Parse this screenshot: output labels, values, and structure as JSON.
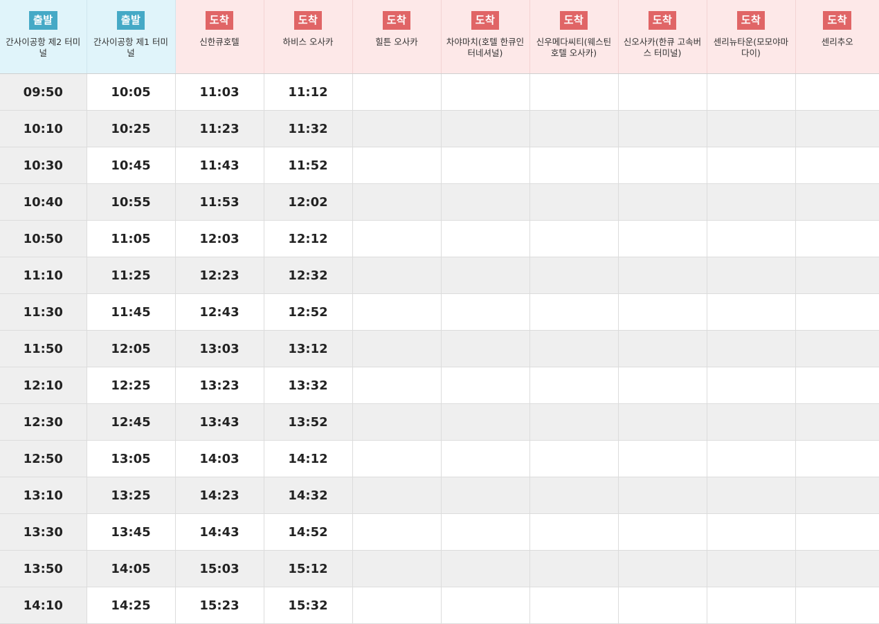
{
  "headers": [
    {
      "badge": "출발",
      "type": "dep",
      "station": "간사이공항 제2 터미널"
    },
    {
      "badge": "출발",
      "type": "dep",
      "station": "간사이공항 제1 터미널"
    },
    {
      "badge": "도착",
      "type": "arr",
      "station": "신한큐호텔"
    },
    {
      "badge": "도착",
      "type": "arr",
      "station": "하비스 오사카"
    },
    {
      "badge": "도착",
      "type": "arr",
      "station": "힐튼 오사카"
    },
    {
      "badge": "도착",
      "type": "arr",
      "station": "차야마치(호텔 한큐인터네셔널)"
    },
    {
      "badge": "도착",
      "type": "arr",
      "station": "신우메다씨티(웨스틴호텔 오사카)"
    },
    {
      "badge": "도착",
      "type": "arr",
      "station": "신오사카(한큐 고속버스 터미널)"
    },
    {
      "badge": "도착",
      "type": "arr",
      "station": "센리뉴타운(모모야마다이)"
    },
    {
      "badge": "도착",
      "type": "arr",
      "station": "센리추오"
    }
  ],
  "rows": [
    [
      "09:50",
      "10:05",
      "11:03",
      "11:12",
      "",
      "",
      "",
      "",
      "",
      ""
    ],
    [
      "10:10",
      "10:25",
      "11:23",
      "11:32",
      "",
      "",
      "",
      "",
      "",
      ""
    ],
    [
      "10:30",
      "10:45",
      "11:43",
      "11:52",
      "",
      "",
      "",
      "",
      "",
      ""
    ],
    [
      "10:40",
      "10:55",
      "11:53",
      "12:02",
      "",
      "",
      "",
      "",
      "",
      ""
    ],
    [
      "10:50",
      "11:05",
      "12:03",
      "12:12",
      "",
      "",
      "",
      "",
      "",
      ""
    ],
    [
      "11:10",
      "11:25",
      "12:23",
      "12:32",
      "",
      "",
      "",
      "",
      "",
      ""
    ],
    [
      "11:30",
      "11:45",
      "12:43",
      "12:52",
      "",
      "",
      "",
      "",
      "",
      ""
    ],
    [
      "11:50",
      "12:05",
      "13:03",
      "13:12",
      "",
      "",
      "",
      "",
      "",
      ""
    ],
    [
      "12:10",
      "12:25",
      "13:23",
      "13:32",
      "",
      "",
      "",
      "",
      "",
      ""
    ],
    [
      "12:30",
      "12:45",
      "13:43",
      "13:52",
      "",
      "",
      "",
      "",
      "",
      ""
    ],
    [
      "12:50",
      "13:05",
      "14:03",
      "14:12",
      "",
      "",
      "",
      "",
      "",
      ""
    ],
    [
      "13:10",
      "13:25",
      "14:23",
      "14:32",
      "",
      "",
      "",
      "",
      "",
      ""
    ],
    [
      "13:30",
      "13:45",
      "14:43",
      "14:52",
      "",
      "",
      "",
      "",
      "",
      ""
    ],
    [
      "13:50",
      "14:05",
      "15:03",
      "15:12",
      "",
      "",
      "",
      "",
      "",
      ""
    ],
    [
      "14:10",
      "14:25",
      "15:23",
      "15:32",
      "",
      "",
      "",
      "",
      "",
      ""
    ]
  ],
  "colors": {
    "departure_badge": "#45a9c6",
    "arrival_badge": "#e06566",
    "departure_header_bg": "#e0f4fa",
    "arrival_header_bg": "#fde8e8",
    "shaded_row_bg": "#efefef"
  }
}
